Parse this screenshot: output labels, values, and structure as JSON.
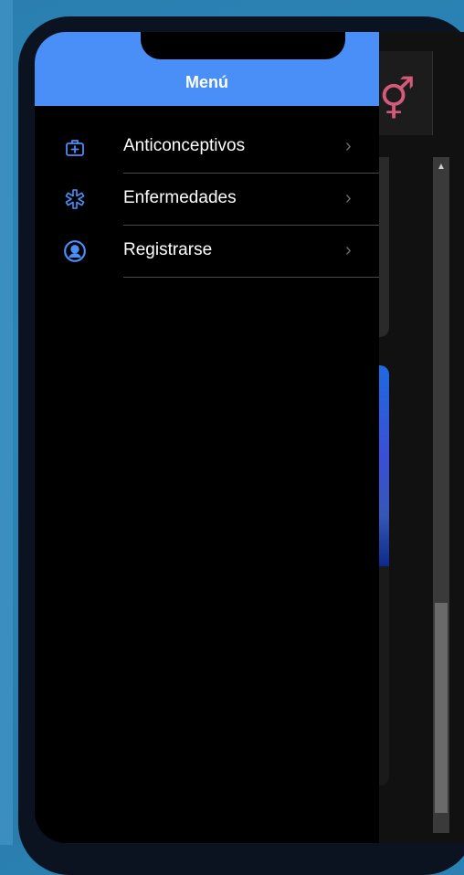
{
  "drawer": {
    "title": "Menú",
    "items": [
      {
        "label": "Anticonceptivos",
        "icon": "medical-bag-icon"
      },
      {
        "label": "Enfermedades",
        "icon": "medical-star-icon"
      },
      {
        "label": "Registrarse",
        "icon": "user-circle-icon"
      }
    ]
  },
  "background_app": {
    "logo_icon": "gender-symbol-icon"
  },
  "colors": {
    "header_bg": "#4a8ff7",
    "icon_accent": "#4a8ff7",
    "logo_pink": "#d45a7a"
  }
}
